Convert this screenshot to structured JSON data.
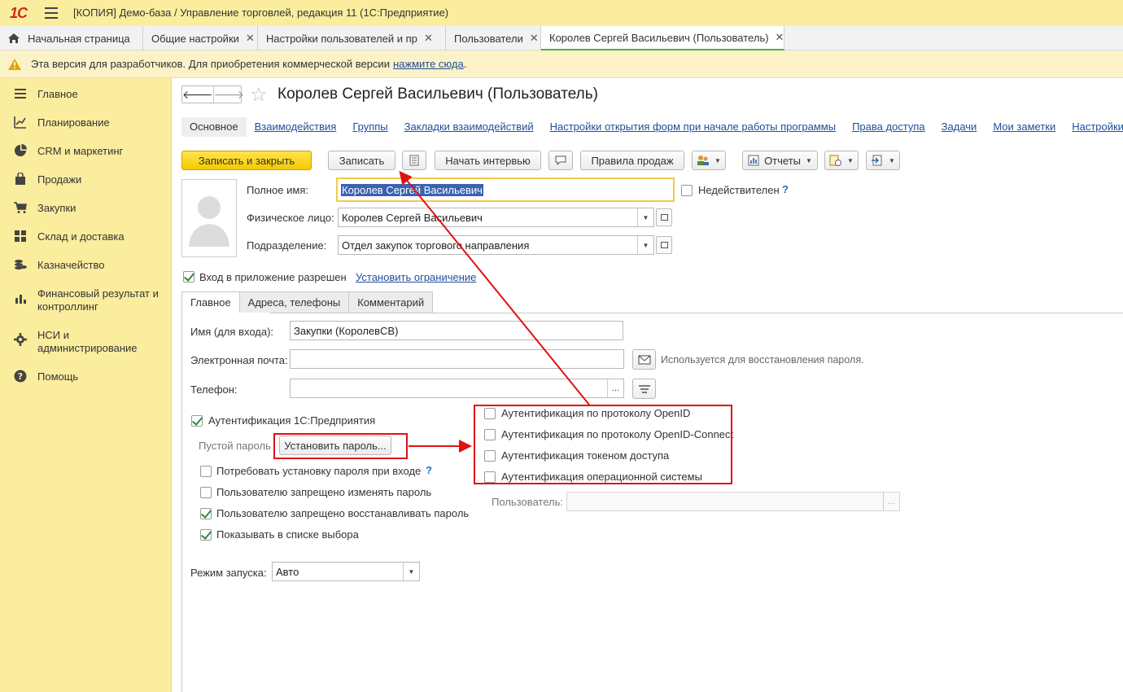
{
  "window": {
    "title": "[КОПИЯ] Демо-база / Управление торговлей, редакция 11  (1С:Предприятие)",
    "logo": "1С"
  },
  "tabs": [
    {
      "label": "Начальная страница"
    },
    {
      "label": "Общие настройки"
    },
    {
      "label": "Настройки пользователей и прав"
    },
    {
      "label": "Пользователи"
    },
    {
      "label": "Королев Сергей Васильевич (Пользователь)"
    }
  ],
  "notice": {
    "text": "Эта версия для разработчиков. Для приобретения коммерческой версии",
    "link": "нажмите сюда",
    "tail": "."
  },
  "sidebar": {
    "items": [
      {
        "label": "Главное",
        "icon": "menu-icon"
      },
      {
        "label": "Планирование",
        "icon": "planning-icon"
      },
      {
        "label": "CRM и маркетинг",
        "icon": "pie-chart-icon"
      },
      {
        "label": "Продажи",
        "icon": "shopping-bag-icon"
      },
      {
        "label": "Закупки",
        "icon": "cart-icon"
      },
      {
        "label": "Склад и доставка",
        "icon": "warehouse-icon"
      },
      {
        "label": "Казначейство",
        "icon": "coins-icon"
      },
      {
        "label": "Финансовый результат и контроллинг",
        "icon": "bar-chart-icon"
      },
      {
        "label": "НСИ и администрирование",
        "icon": "gear-icon"
      },
      {
        "label": "Помощь",
        "icon": "help-icon"
      }
    ]
  },
  "form": {
    "title": "Королев Сергей Васильевич (Пользователь)",
    "sections": [
      "Основное",
      "Взаимодействия",
      "Группы",
      "Закладки взаимодействий",
      "Настройки открытия форм при начале работы программы",
      "Права доступа",
      "Задачи",
      "Мои заметки",
      "Настройки"
    ],
    "toolbar": {
      "save_close": "Записать и закрыть",
      "save": "Записать",
      "interview": "Начать интервью",
      "sales_rules": "Правила продаж",
      "reports": "Отчеты"
    },
    "full_name_label": "Полное имя:",
    "full_name_value": "Королев Сергей Васильевич",
    "inactive_label": "Недействителен",
    "person_label": "Физическое лицо:",
    "person_value": "Королев Сергей Васильевич",
    "dept_label": "Подразделение:",
    "dept_value": "Отдел закупок торгового направления",
    "login_allowed_label": "Вход в приложение разрешен",
    "set_restriction_link": "Установить ограничение",
    "page_tabs": [
      "Главное",
      "Адреса, телефоны",
      "Комментарий"
    ],
    "login_name_label": "Имя (для входа):",
    "login_name_value": "Закупки (КоролевСВ)",
    "email_label": "Электронная почта:",
    "email_value": "",
    "email_hint": "Используется для восстановления пароля.",
    "phone_label": "Телефон:",
    "phone_value": "",
    "auth_1c_label": "Аутентификация 1С:Предприятия",
    "empty_password_label": "Пустой пароль",
    "set_password_button": "Установить пароль...",
    "require_password_label": "Потребовать установку пароля при входе",
    "forbid_change_label": "Пользователю запрещено изменять пароль",
    "forbid_restore_label": "Пользователю запрещено восстанавливать пароль",
    "show_in_list_label": "Показывать в списке выбора",
    "auth_openid_label": "Аутентификация по протоколу OpenID",
    "auth_openid_connect_label": "Аутентификация по протоколу OpenID-Connect",
    "auth_token_label": "Аутентификация токеном доступа",
    "auth_os_label": "Аутентификация операционной системы",
    "os_user_label": "Пользователь:",
    "os_user_value": "",
    "launch_mode_label": "Режим запуска:",
    "launch_mode_value": "Авто",
    "dots": "..."
  },
  "checkboxes": {
    "inactive": false,
    "login_allowed": true,
    "auth_1c": true,
    "require_password": false,
    "forbid_change": false,
    "forbid_restore": true,
    "show_in_list": true,
    "auth_openid": false,
    "auth_openid_connect": false,
    "auth_token": false,
    "auth_os": false
  },
  "colors": {
    "annotation_red": "#e01010",
    "sidebar_yellow": "#fbed9e",
    "primary_button": "#f5c900",
    "link_blue": "#1f4e9c"
  }
}
